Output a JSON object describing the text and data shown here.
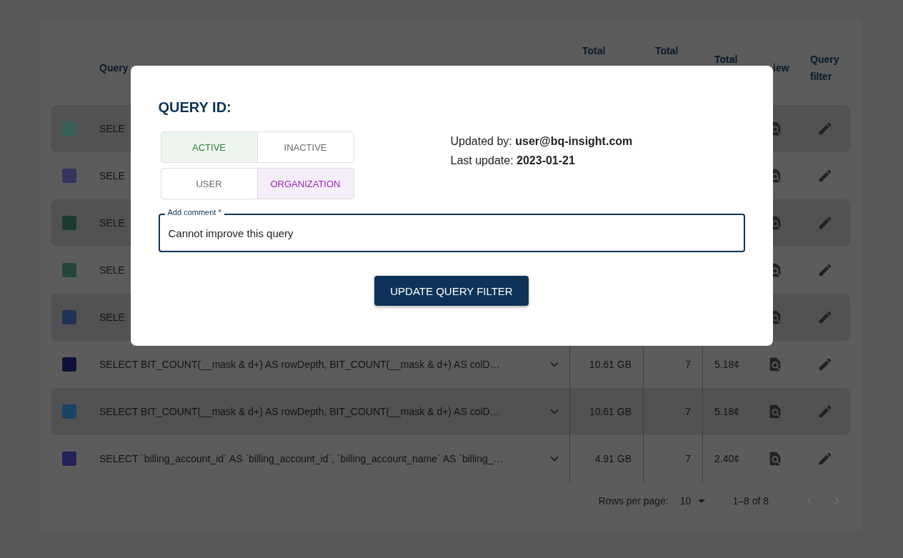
{
  "table": {
    "columns": [
      "Query",
      "Total",
      "Total",
      "Total",
      "iew",
      "Query filter"
    ],
    "rows": [
      {
        "color": "#356156",
        "query": "SELE"
      },
      {
        "color": "#35345e",
        "query": "SELE"
      },
      {
        "color": "#1e3a32",
        "query": "SELE"
      },
      {
        "color": "#26463c",
        "query": "SELE"
      },
      {
        "color": "#213356",
        "query": "SELE"
      },
      {
        "color": "#10103c",
        "query": "SELECT BIT_COUNT(__mask & d+) AS rowDepth, BIT_COUNT(__mask & d+) AS colD…",
        "bytes": "10.61 GB",
        "count": "7",
        "cost": "5.18¢"
      },
      {
        "color": "#1a4466",
        "query": "SELECT BIT_COUNT(__mask & d+) AS rowDepth, BIT_COUNT(__mask & d+) AS colD…",
        "bytes": "10.61 GB",
        "count": "7",
        "cost": "5.18¢"
      },
      {
        "color": "#23225a",
        "query": "SELECT `billing_account_id` AS `billing_account_id`, `billing_account_name` AS `billing_…",
        "bytes": "4.91 GB",
        "count": "7",
        "cost": "2.40¢"
      }
    ]
  },
  "pagination": {
    "rows_per_page_label": "Rows per page:",
    "rows_per_page": "10",
    "range": "1–8 of 8",
    "prev_disabled": true,
    "next_disabled": true
  },
  "dialog": {
    "title": "QUERY ID:",
    "toggle_groups": [
      {
        "kind": "success",
        "options": [
          {
            "label": "ACTIVE",
            "selected": true
          },
          {
            "label": "INACTIVE",
            "selected": false
          }
        ]
      },
      {
        "kind": "secondary",
        "options": [
          {
            "label": "USER",
            "selected": false
          },
          {
            "label": "ORGANIZATION",
            "selected": true
          }
        ]
      }
    ],
    "updated_by_label": "Updated by:",
    "updated_by": "user@bq-insight.com",
    "last_update_label": "Last update:",
    "last_update": "2023-01-21",
    "comment": {
      "label": "Add comment *",
      "value": "Cannot improve this query"
    },
    "button": "UPDATE QUERY FILTER"
  }
}
